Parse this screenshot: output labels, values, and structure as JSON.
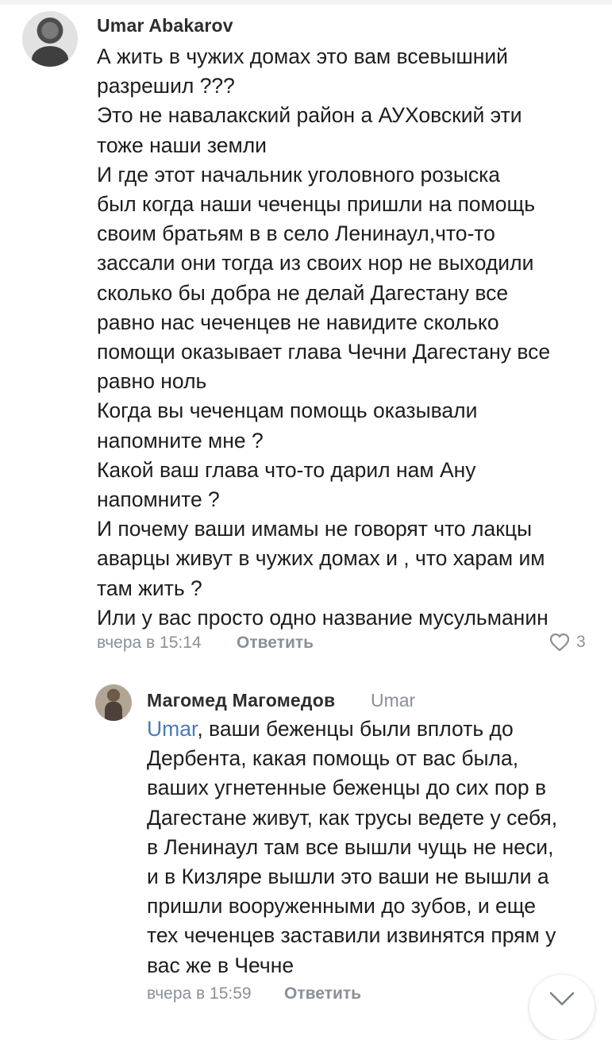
{
  "comments": [
    {
      "author": "Umar Abakarov",
      "text": "А жить в чужих домах это вам всевышний\nразрешил ???\nЭто не навалакский район а АУХовский эти\nтоже наши земли\nИ где этот начальник уголовного розыска\nбыл когда наши чеченцы пришли на помощь\nсвоим братьям в в село Ленинаул,что-то\nзассали они тогда из своих нор не выходили\nсколько бы добра не делай Дагестану все\nравно нас чеченцев не навидите сколько\nпомощи оказывает глава Чечни Дагестану все\nравно ноль\nКогда вы чеченцам помощь оказывали\nнапомните мне ?\nКакой ваш глава что-то дарил нам Ану\nнапомните ?\nИ почему ваши имамы не говорят что лакцы\nаварцы живут в чужих домах и , что харам им\nтам жить ?\nИли у вас просто одно название мусульманин",
      "time": "вчера в 15:14",
      "reply_label": "Ответить",
      "likes": "3"
    }
  ],
  "replies": [
    {
      "author": "Магомед Магомедов",
      "reply_to": "Umar",
      "mention": "Umar",
      "text": ", ваши беженцы были вплоть до\nДербента, какая помощь от вас была,\nваших угнетенные беженцы до сих пор в\nДагестане живут, как трусы ведете у себя,\nв Ленинаул там все вышли чущь не неси,\nи в Кизляре вышли это ваши не вышли а\nпришли вооруженными до зубов, и еще\nтех чеченцев заставили извинятся прям у\nвас же в Чечне",
      "time": "вчера в 15:59",
      "reply_label": "Ответить"
    }
  ],
  "icons": {
    "like": "heart-outline-icon",
    "scroll": "chevron-down-icon"
  },
  "colors": {
    "meta": "#8a9099",
    "mention": "#4a7ab7",
    "text": "#1d1d1f"
  }
}
